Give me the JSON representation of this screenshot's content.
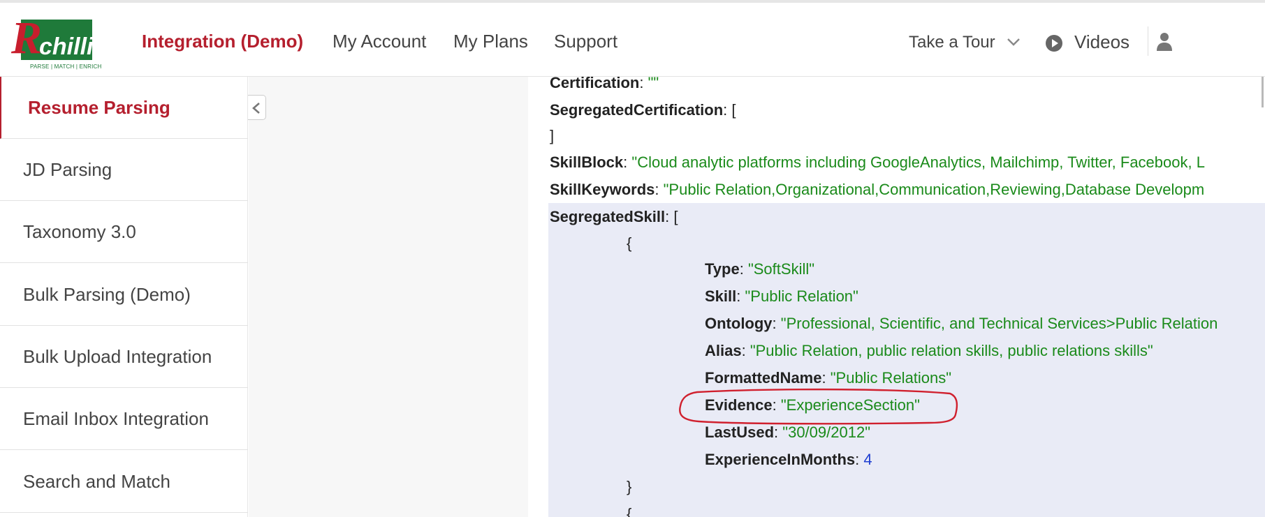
{
  "brand": {
    "logo_text": "Rchilli",
    "tagline": "PARSE | MATCH | ENRICH"
  },
  "nav": {
    "items": [
      "Integration (Demo)",
      "My Account",
      "My Plans",
      "Support"
    ],
    "take_tour": "Take a Tour",
    "videos": "Videos"
  },
  "sidebar": {
    "items": [
      {
        "label": "Resume Parsing",
        "active": true
      },
      {
        "label": "JD Parsing"
      },
      {
        "label": "Taxonomy 3.0"
      },
      {
        "label": "Bulk Parsing (Demo)"
      },
      {
        "label": "Bulk Upload Integration"
      },
      {
        "label": "Email Inbox Integration"
      },
      {
        "label": "Search and Match"
      }
    ]
  },
  "json_view": {
    "certification": {
      "key": "Certification",
      "value": "\"\""
    },
    "segregated_certification": {
      "key": "SegregatedCertification",
      "open": "[",
      "close": "]"
    },
    "skill_block": {
      "key": "SkillBlock",
      "value": "\"Cloud analytic platforms including GoogleAnalytics, Mailchimp, Twitter, Facebook, L"
    },
    "skill_keywords": {
      "key": "SkillKeywords",
      "value": "\"Public Relation,Organizational,Communication,Reviewing,Database Developm"
    },
    "segregated_skill": {
      "key": "SegregatedSkill",
      "open": "[",
      "obj_open": "{",
      "obj_close": "}",
      "next_obj_open": "{"
    },
    "skill_fields": [
      {
        "key": "Type",
        "value": "\"SoftSkill\""
      },
      {
        "key": "Skill",
        "value": "\"Public Relation\""
      },
      {
        "key": "Ontology",
        "value": "\"Professional, Scientific, and Technical Services>Public Relation"
      },
      {
        "key": "Alias",
        "value": "\"Public Relation, public relation skills, public relations skills\""
      },
      {
        "key": "FormattedName",
        "value": "\"Public Relations\""
      },
      {
        "key": "Evidence",
        "value": "\"ExperienceSection\""
      },
      {
        "key": "LastUsed",
        "value": "\"30/09/2012\""
      },
      {
        "key": "ExperienceInMonths",
        "value": "4",
        "numeric": true
      }
    ]
  },
  "colors": {
    "brand_red": "#b51f2e",
    "logo_green": "#1f7a3a",
    "string_green": "#1a8a1a",
    "number_blue": "#1f3fd1",
    "highlight": "#e9ebf6",
    "annotation_red": "#d0202e"
  }
}
